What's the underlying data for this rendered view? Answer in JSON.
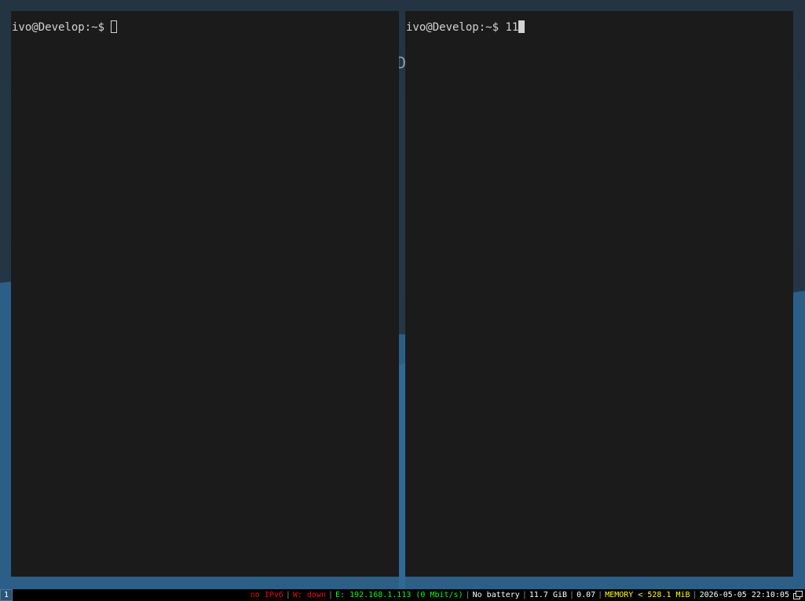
{
  "terminals": [
    {
      "prompt": "ivo@Develop:~$",
      "input": "",
      "cursor": "hollow"
    },
    {
      "prompt": "ivo@Develop:~$",
      "input": "11",
      "cursor": "block"
    }
  ],
  "desktop": {
    "glyph": "D"
  },
  "statusbar": {
    "workspace": "1",
    "ipv6": "no IPv6",
    "wireless": "W: down",
    "ethernet": "E: 192.168.1.113 (0 Mbit/s)",
    "battery": "No battery",
    "disk": "11.7 GiB",
    "load": "0.07",
    "memory": "MEMORY < 528.1 MiB",
    "datetime": "2026-05-05 22:10:05",
    "colors": {
      "bad": "#ff0000",
      "good": "#00ff00",
      "degraded": "#ffff00",
      "normal": "#ffffff"
    }
  }
}
